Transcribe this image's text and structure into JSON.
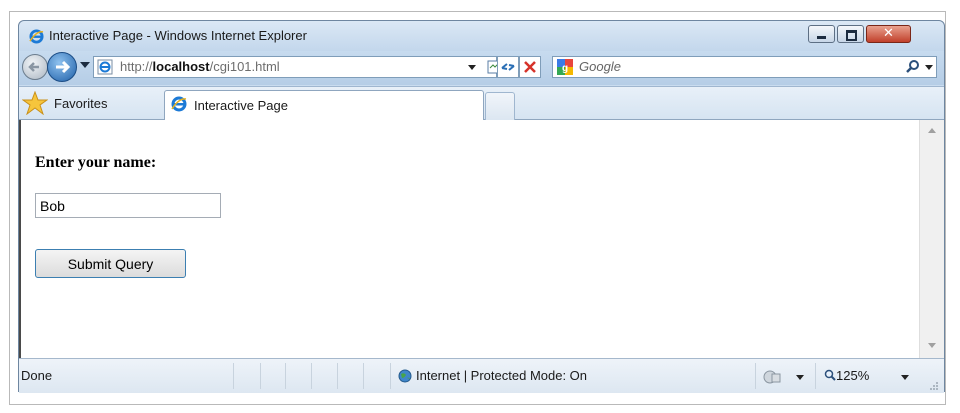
{
  "window": {
    "title": "Interactive Page - Windows Internet Explorer",
    "controls": {
      "minimize": "minimize-icon",
      "maximize": "maximize-icon",
      "close": "✕"
    }
  },
  "navigation": {
    "address_prefix": "http://",
    "address_host": "localhost",
    "address_path": "/cgi101.html",
    "search_placeholder": "Google"
  },
  "tabs": {
    "favorites_label": "Favorites",
    "active_tab_label": "Interactive Page"
  },
  "content": {
    "prompt": "Enter your name:",
    "name_value": "Bob",
    "submit_label": "Submit Query"
  },
  "status": {
    "text": "Done",
    "zone": "Internet | Protected Mode: On",
    "zoom": "125%"
  },
  "colors": {
    "accent": "#3c7fb1",
    "chrome": "#c9dcef",
    "close": "#c1402b"
  }
}
